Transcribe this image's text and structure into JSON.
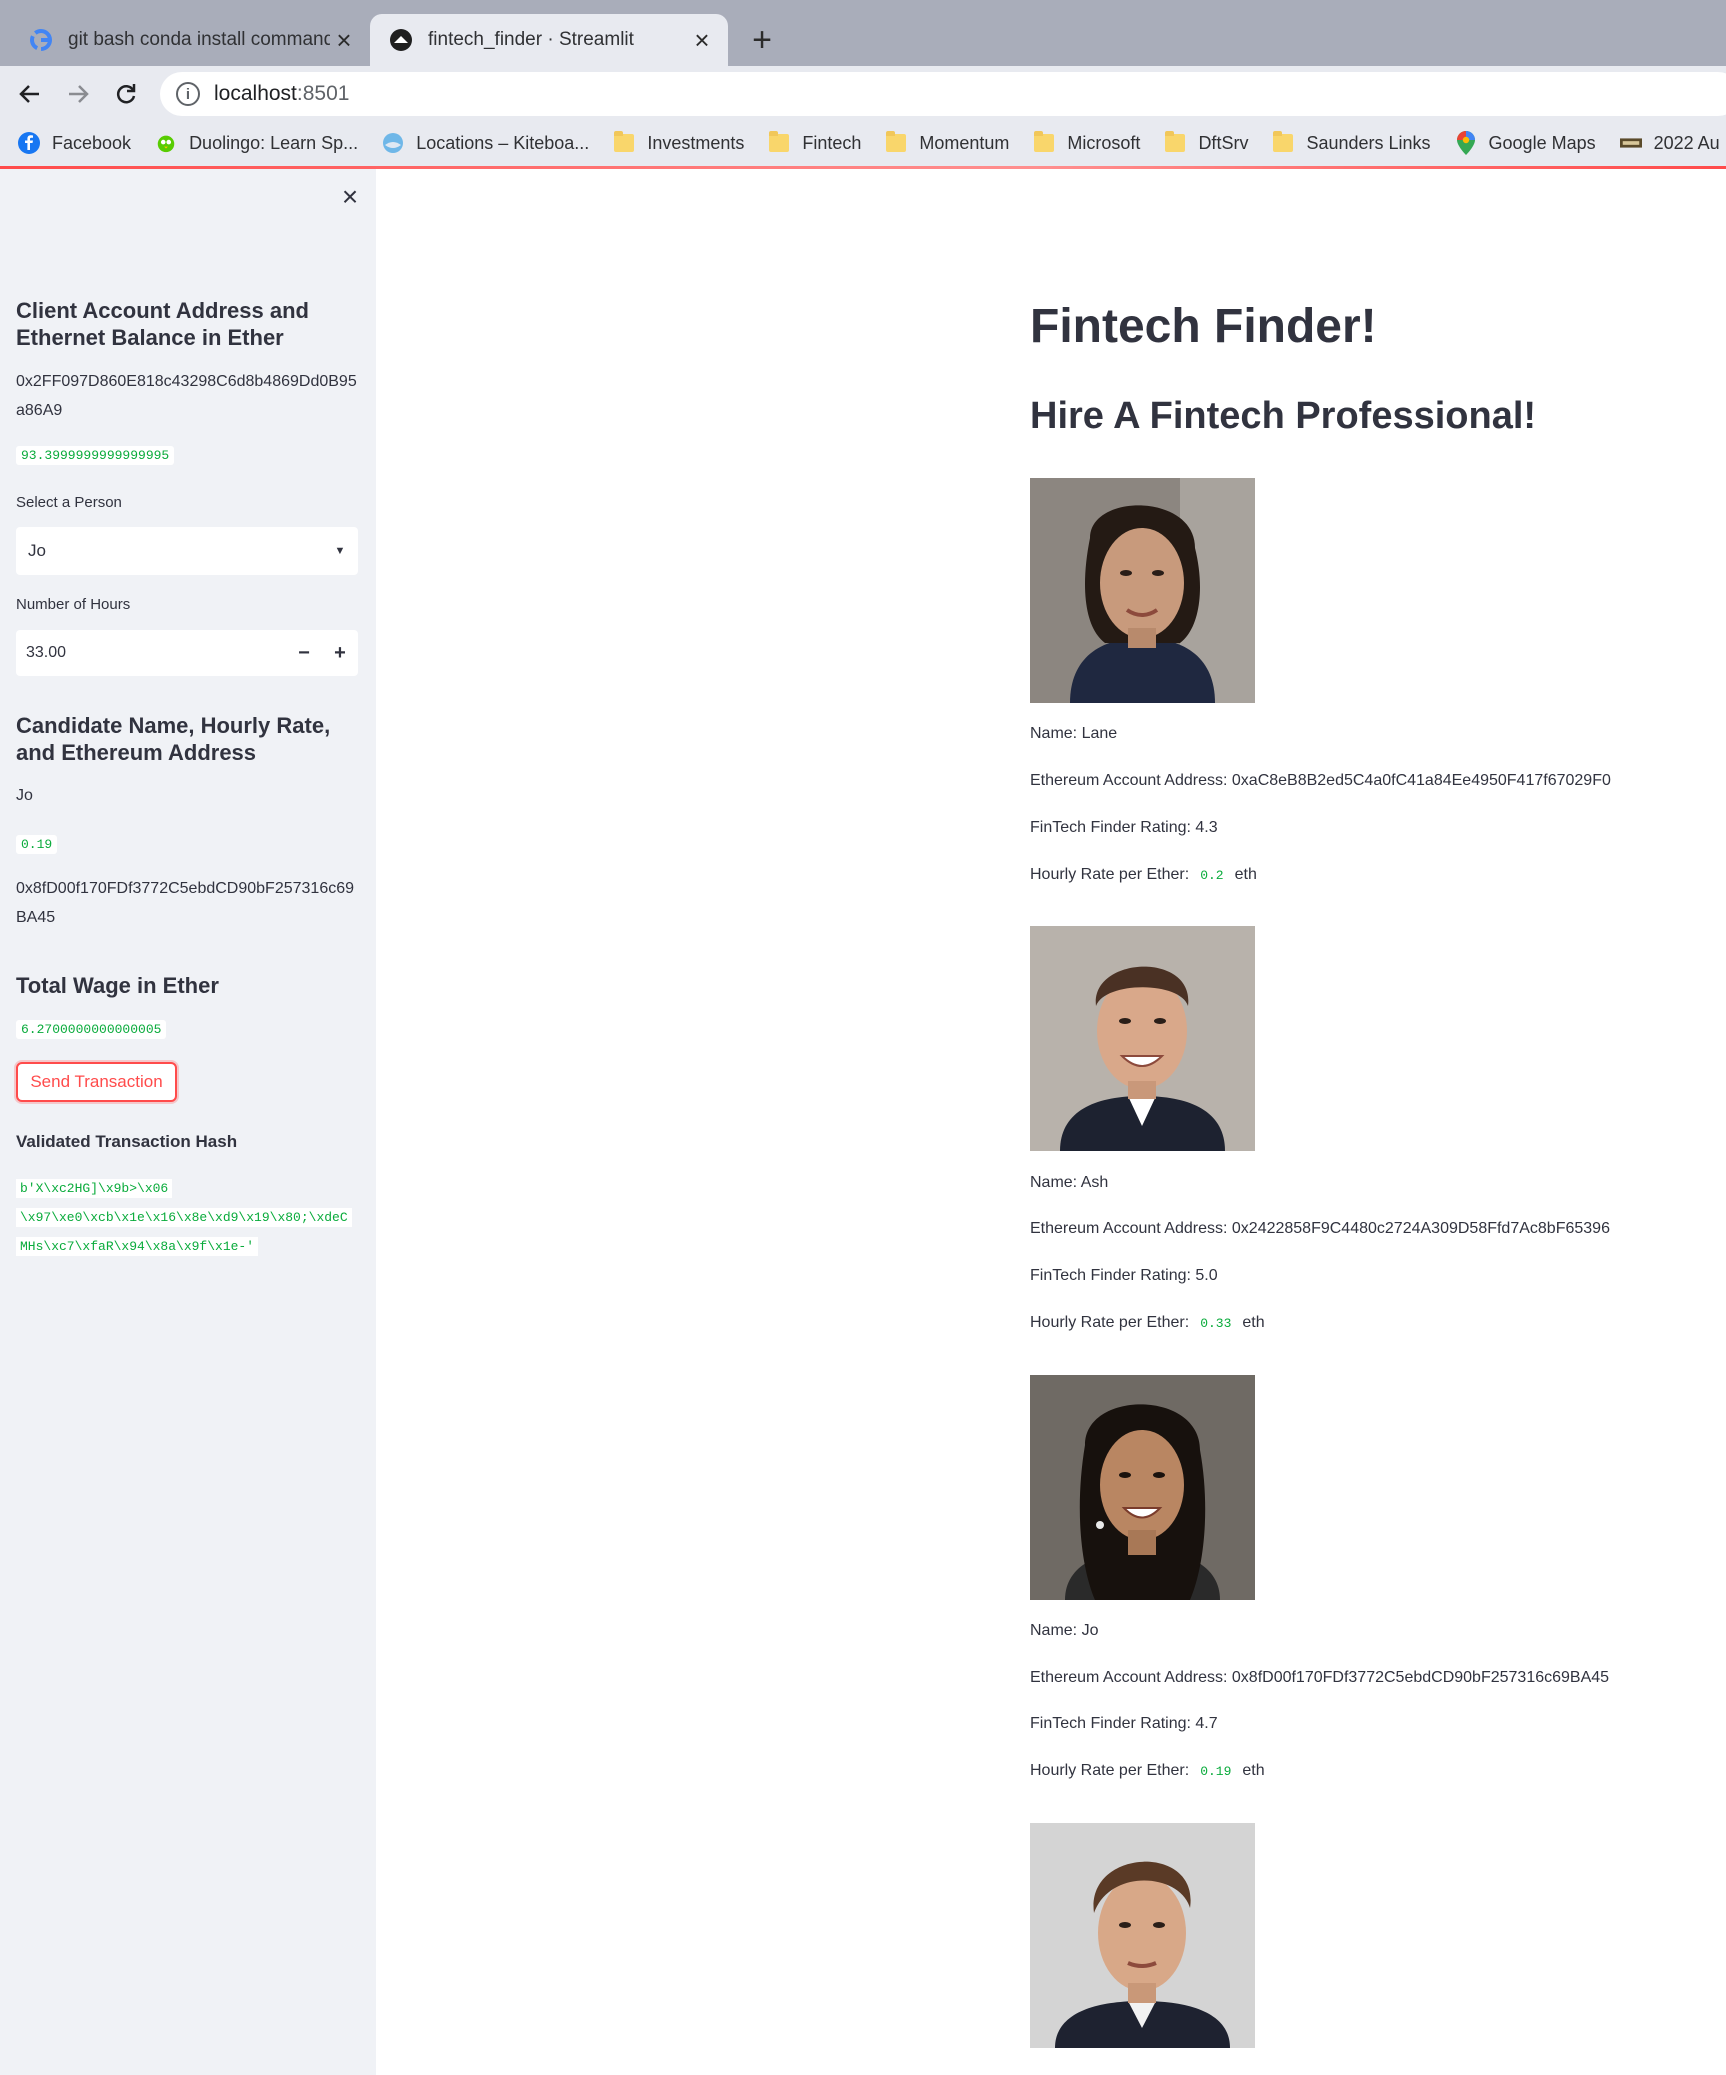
{
  "browser": {
    "tabs": [
      {
        "title": "git bash conda install command",
        "active": false,
        "icon": "google-icon"
      },
      {
        "title": "fintech_finder · Streamlit",
        "active": true,
        "icon": "streamlit-icon"
      }
    ],
    "address": {
      "host": "localhost",
      "port": ":8501"
    },
    "bookmarks": [
      {
        "label": "Facebook",
        "icon": "facebook-icon"
      },
      {
        "label": "Duolingo: Learn Sp...",
        "icon": "duolingo-icon"
      },
      {
        "label": "Locations – Kiteboa...",
        "icon": "globe-icon"
      },
      {
        "label": "Investments",
        "icon": "folder-icon"
      },
      {
        "label": "Fintech",
        "icon": "folder-icon"
      },
      {
        "label": "Momentum",
        "icon": "folder-icon"
      },
      {
        "label": "Microsoft",
        "icon": "folder-icon"
      },
      {
        "label": "DftSrv",
        "icon": "folder-icon"
      },
      {
        "label": "Saunders Links",
        "icon": "folder-icon"
      },
      {
        "label": "Google Maps",
        "icon": "maps-pin-icon"
      },
      {
        "label": "2022 Au",
        "icon": "site-icon"
      }
    ]
  },
  "sidebar": {
    "account_heading": "Client Account Address and Ethernet Balance in Ether",
    "account_address": "0x2FF097D860E818c43298C6d8b4869Dd0B95a86A9",
    "balance": "93.3999999999999995",
    "select_label": "Select a Person",
    "select_value": "Jo",
    "hours_label": "Number of Hours",
    "hours_value": "33.00",
    "candidate_heading": "Candidate Name, Hourly Rate, and Ethereum Address",
    "candidate_name": "Jo",
    "candidate_rate": "0.19",
    "candidate_address": "0x8fD00f170FDf3772C5ebdCD90bF257316c69BA45",
    "wage_heading": "Total Wage in Ether",
    "wage_value": "6.2700000000000005",
    "send_button": "Send Transaction",
    "hash_heading": "Validated Transaction Hash",
    "hash_lines": [
      "b'X\\xc2HG]\\x9b>\\x06",
      "\\x97\\xe0\\xcb\\x1e\\x16\\x8e\\xd9\\x19\\x80;\\xdeC",
      "MHs\\xc7\\xfaR\\x94\\x8a\\x9f\\x1e-'"
    ]
  },
  "main": {
    "title": "Fintech Finder!",
    "subtitle": "Hire A Fintech Professional!",
    "rate_unit": "eth",
    "candidates": [
      {
        "name": "Name: Lane",
        "address": "Ethereum Account Address: 0xaC8eB8B2ed5C4a0fC41a84Ee4950F417f67029F0",
        "rating": "FinTech Finder Rating: 4.3",
        "rate_label": "Hourly Rate per Ether:",
        "rate": "0.2"
      },
      {
        "name": "Name: Ash",
        "address": "Ethereum Account Address: 0x2422858F9C4480c2724A309D58Ffd7Ac8bF65396",
        "rating": "FinTech Finder Rating: 5.0",
        "rate_label": "Hourly Rate per Ether:",
        "rate": "0.33"
      },
      {
        "name": "Name: Jo",
        "address": "Ethereum Account Address: 0x8fD00f170FDf3772C5ebdCD90bF257316c69BA45",
        "rating": "FinTech Finder Rating: 4.7",
        "rate_label": "Hourly Rate per Ether:",
        "rate": "0.19"
      }
    ]
  }
}
